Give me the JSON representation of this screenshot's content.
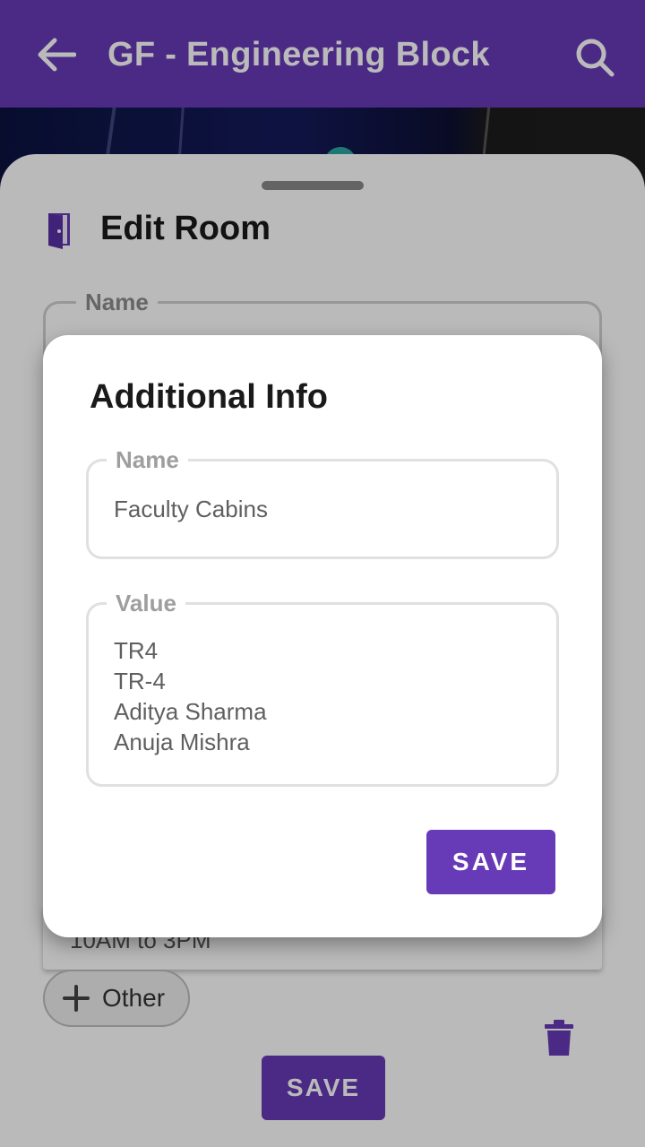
{
  "appbar": {
    "title": "GF - Engineering Block",
    "back_icon": "arrow-left-icon",
    "search_icon": "search-icon",
    "color": "#673ab7"
  },
  "sheet": {
    "title": "Edit Room",
    "title_icon": "door-icon",
    "name_field_label": "Name",
    "time_text": "10AM to 3PM",
    "other_chip_label": "Other",
    "delete_icon": "trash-icon",
    "save_label": "SAVE"
  },
  "dialog": {
    "title": "Additional Info",
    "name_label": "Name",
    "name_value": "Faculty Cabins",
    "value_label": "Value",
    "value_lines": [
      "TR4",
      "TR-4",
      "Aditya Sharma",
      "Anuja Mishra"
    ],
    "save_label": "SAVE"
  },
  "colors": {
    "accent": "#673ab7",
    "scrim": "rgba(0,0,0,0.27)"
  }
}
